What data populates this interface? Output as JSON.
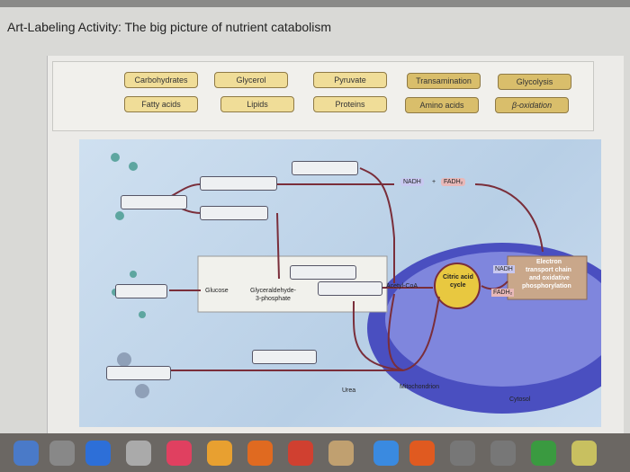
{
  "header": {
    "title": "Art-Labeling Activity: The big picture of nutrient catabolism"
  },
  "labels": [
    {
      "text": "Carbohydrates"
    },
    {
      "text": "Glycerol"
    },
    {
      "text": "Pyruvate"
    },
    {
      "text": "Transamination"
    },
    {
      "text": "Glycolysis"
    },
    {
      "text": "Fatty acids"
    },
    {
      "text": "Lipids"
    },
    {
      "text": "Proteins"
    },
    {
      "text": "Amino acids"
    },
    {
      "text": "β-oxidation"
    }
  ],
  "diagram": {
    "nadh": "NADH",
    "plus": "+",
    "fadh2": "FADH₂",
    "glucose": "Glucose",
    "g3p_1": "Glyceraldehyde-",
    "g3p_2": "3-phosphate",
    "acetyl_coa": "Acetyl-CoA",
    "citric_1": "Citric acid",
    "citric_2": "cycle",
    "etc_1": "Electron",
    "etc_2": "transport chain",
    "etc_3": "and oxidative",
    "etc_4": "phosphorylation",
    "urea": "Urea",
    "mitochondrion": "Mitochondrion",
    "cytosol": "Cytosol"
  },
  "colors": {
    "label_fill": "#f0dd98",
    "arrow": "#7a2e3a",
    "mito": "#4a4fc0",
    "citric": "#e8c840",
    "etc": "#c9a78a"
  }
}
